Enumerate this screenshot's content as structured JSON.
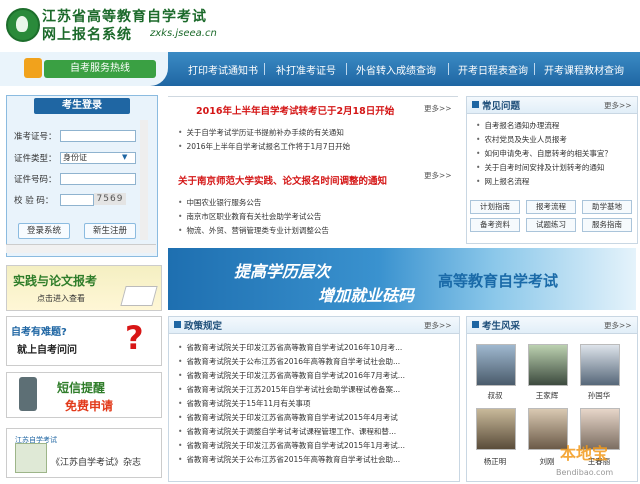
{
  "header": {
    "title": "江苏省高等教育自学考试",
    "subtitle": "网上报名系统",
    "url": "zxks.jseea.cn"
  },
  "nav": {
    "hotline": "自考服务热线",
    "items": [
      "打印考试通知书",
      "补打准考证号",
      "外省转入成绩查询",
      "开考日程表查询",
      "开考课程教材查询"
    ]
  },
  "login": {
    "title": "考生登录",
    "fields": [
      {
        "label": "准考证号：",
        "value": ""
      },
      {
        "label": "证件类型：",
        "value": "身份证"
      },
      {
        "label": "证件号码：",
        "value": ""
      },
      {
        "label": "校 验 码：",
        "value": ""
      }
    ],
    "captcha": "7569",
    "login_button": "登录系统",
    "register_button": "新生注册"
  },
  "banners": {
    "practice": {
      "title": "实践与论文报考",
      "link": "点击进入查看"
    },
    "ask": {
      "line1": "自考有难题?",
      "line2": "就上自考问问",
      "mark": "?"
    },
    "sms": {
      "title": "短信提醒",
      "sub": "免费申请"
    },
    "guide": {
      "badge": "江苏自学考试",
      "text": "《江苏自学考试》杂志"
    }
  },
  "news": {
    "headline1": "2016年上半年自学考试转考已于2月18日开始",
    "items1": [
      "关于自学考试学历证书提前补办手续的有关通知",
      "2016年上半年自学考试报名工作将于1月7日开始"
    ],
    "headline2": "关于南京师范大学实践、论文报名时间调整的通知",
    "items2": [
      "中国农业银行服务公告",
      "南京市区职业教育有关社会助学考试公告",
      "物流、外贸、营销管理类专业计划调整公告"
    ],
    "more": "更多>>"
  },
  "big_banner": {
    "line1": "提高学历层次",
    "line2": "增加就业砝码",
    "line3": "高等教育自学考试"
  },
  "faq": {
    "title": "常见问题",
    "more": "更多>>",
    "items": [
      "自考报名通知办理流程",
      "农村党员及失业人员报考",
      "如何申请免考、自愿转考的相关事宜？",
      "关于自考时间安排及计划转考的通知",
      "网上报名流程"
    ],
    "buttons": [
      "计划指南",
      "报考流程",
      "助学基地",
      "备考资料",
      "试题练习",
      "服务指南"
    ]
  },
  "policy": {
    "title": "政策规定",
    "more": "更多>>",
    "items": [
      "省教育考试院关于印发江苏省高等教育自学考试2016年10月考...",
      "省教育考试院关于公布江苏省2016年高等教育自学考试社会助...",
      "省教育考试院关于印发江苏省高等教育自学考试2016年7月考试...",
      "省教育考试院关于江苏2015年自学考试社会助学课程试卷备案...",
      "省教育考试院关于15年11月有关事项",
      "省教育考试院关于印发江苏省高等教育自学考试2015年4月考试",
      "省教育考试院关于调整自学考试考试课程管理工作、课程和替...",
      "省教育考试院关于印发江苏省高等教育自学考试2015年1月考试...",
      "省教育考试院关于公布江苏省2015年高等教育自学考试社会助..."
    ]
  },
  "style": {
    "title": "考生风采",
    "more": "更多>>",
    "people": [
      "叔叔",
      "王家辉",
      "孙国华",
      "杨正明",
      "刘刚",
      "王春丽"
    ]
  },
  "watermark": {
    "text": "本地宝",
    "site": "Bendibao.com"
  },
  "colors": {
    "primary": "#1f66a3",
    "accent": "#d41515",
    "green": "#2f7d2a"
  }
}
